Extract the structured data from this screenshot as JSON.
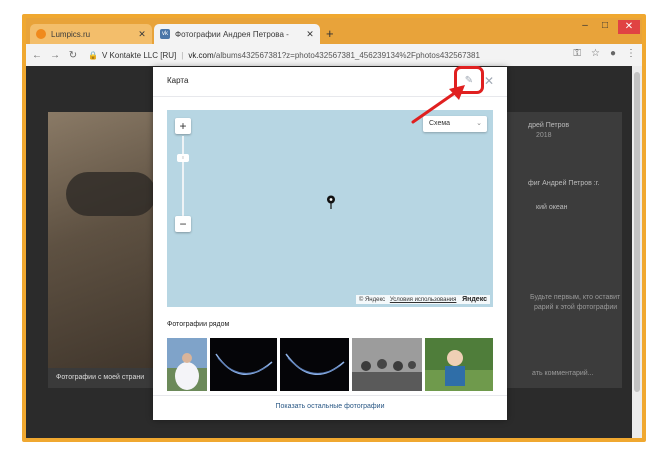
{
  "browser": {
    "tabs": [
      {
        "title": "Lumpics.ru",
        "active": false
      },
      {
        "title": "Фотографии Андрея Петрова -",
        "active": true
      }
    ],
    "newtab_label": "+",
    "window_controls": [
      "–",
      "□",
      "✕"
    ],
    "address": {
      "site_label": "V Kontakte LLC [RU]",
      "separator": "|",
      "domain": "vk.com",
      "path": "/albums432567381?z=photo432567381_456239134%2Fphotos432567381"
    }
  },
  "background": {
    "caption": "Фотографии с моей страни",
    "name": "дрей Петров",
    "date": "2018",
    "album": "фиг Андрей Петров :г.",
    "location": "кий океан",
    "comment_hint": "Будьте первым, кто оставит",
    "comment_hint2": "рарий к этой фотографии",
    "comment_input": "ать комментарий..."
  },
  "modal": {
    "title": "Карта",
    "map": {
      "type_select": "Схема",
      "zoom_plus": "+",
      "zoom_minus": "−",
      "attribution_copy": "© Яндекс",
      "attribution_link": "Условия использования",
      "attribution_brand": "Яндекс"
    },
    "nearby_title": "Фотографии рядом",
    "show_more": "Показать остальные фотографии"
  },
  "colors": {
    "accent_highlight": "#e02020",
    "map_water": "#b7d6e3",
    "link": "#2a5885"
  }
}
